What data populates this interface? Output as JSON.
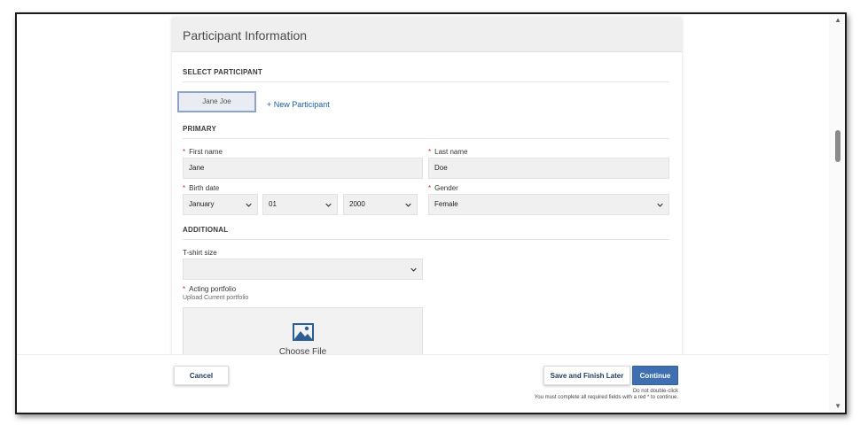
{
  "card": {
    "title": "Participant Information"
  },
  "sections": {
    "select_participant": "SELECT PARTICIPANT",
    "primary": "PRIMARY",
    "additional": "ADDITIONAL"
  },
  "participant": {
    "selected": "Jane Joe",
    "new_label": "+ New Participant"
  },
  "fields": {
    "first_name": {
      "label": "First name",
      "value": "Jane"
    },
    "last_name": {
      "label": "Last name",
      "value": "Doe"
    },
    "birth_date": {
      "label": "Birth date",
      "month": "January",
      "day": "01",
      "year": "2000"
    },
    "gender": {
      "label": "Gender",
      "value": "Female"
    },
    "tshirt": {
      "label": "T-shirt size",
      "value": ""
    },
    "portfolio": {
      "label": "Acting portfolio",
      "sublabel": "Upload Current portfolio",
      "choose": "Choose File"
    }
  },
  "required_marker": "*",
  "footer": {
    "cancel": "Cancel",
    "save_later": "Save and Finish Later",
    "continue": "Continue",
    "note1": "Do not double-click",
    "note2": "You must complete all required fields with a red * to continue."
  },
  "icons": {
    "chevron": "chevron-down-icon",
    "image": "image-icon"
  },
  "colors": {
    "accent": "#3e6fb0",
    "link": "#1c5fa5",
    "required": "#d9241c"
  }
}
